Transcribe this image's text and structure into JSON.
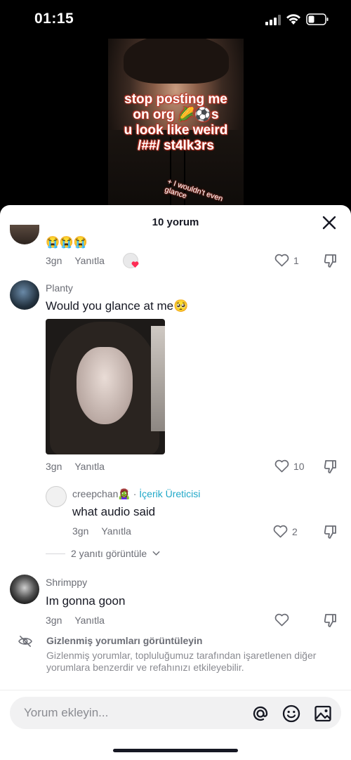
{
  "status_bar": {
    "time": "01:15"
  },
  "video": {
    "overlay_lines": [
      "stop posting me",
      "on org 🌽⚽s",
      "u look like weird",
      "/##/ st4lk3rs"
    ],
    "overlay_small": "+ I wouldn't even glance"
  },
  "sheet": {
    "title": "10 yorum"
  },
  "comments": [
    {
      "text": "😭😭😭",
      "age": "3gn",
      "reply_label": "Yanıtla",
      "likes": "1"
    },
    {
      "username": "Planty",
      "text": "Would you glance at me🥺",
      "age": "3gn",
      "reply_label": "Yanıtla",
      "likes": "10"
    },
    {
      "username": "Shrimppy",
      "text": "Im gonna goon",
      "age": "3gn",
      "reply_label": "Yanıtla",
      "likes": ""
    }
  ],
  "reply": {
    "username": "creepchan🧟‍♀️",
    "separator": "·",
    "badge": "İçerik Üreticisi",
    "text": "what audio said",
    "age": "3gn",
    "reply_label": "Yanıtla",
    "likes": "2"
  },
  "view_more": "2 yanıtı görüntüle",
  "hidden": {
    "title": "Gizlenmiş yorumları görüntüleyin",
    "description": "Gizlenmiş yorumlar, topluluğumuz tarafından işaretlenen diğer yorumlara benzerdir ve refahınızı etkileyebilir."
  },
  "input": {
    "placeholder": "Yorum ekleyin..."
  },
  "colors": {
    "accent_creator": "#20a8c8",
    "liked_heart": "#fe2c55",
    "text_primary": "#161823",
    "text_secondary": "#6b6d75"
  }
}
